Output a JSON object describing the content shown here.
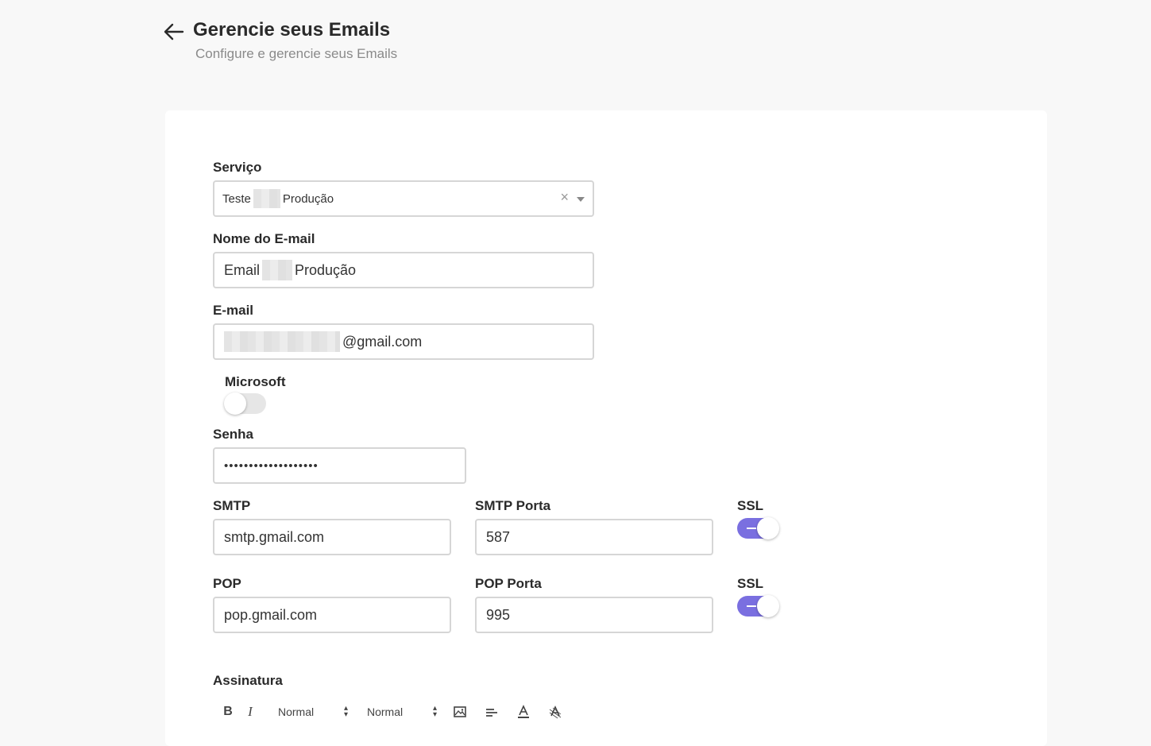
{
  "header": {
    "title": "Gerencie seus Emails",
    "subtitle": "Configure e gerencie seus Emails"
  },
  "form": {
    "servico": {
      "label": "Serviço",
      "value_prefix": "Teste",
      "value_suffix": "Produção"
    },
    "nome_email": {
      "label": "Nome do E-mail",
      "value_prefix": "Email",
      "value_suffix": "Produção"
    },
    "email": {
      "label": "E-mail",
      "value_suffix": "@gmail.com"
    },
    "microsoft": {
      "label": "Microsoft",
      "enabled": false
    },
    "senha": {
      "label": "Senha",
      "value": "•••••••••••••••••••"
    },
    "smtp": {
      "label": "SMTP",
      "value": "smtp.gmail.com"
    },
    "smtp_porta": {
      "label": "SMTP Porta",
      "value": "587"
    },
    "smtp_ssl": {
      "label": "SSL",
      "enabled": true
    },
    "pop": {
      "label": "POP",
      "value": "pop.gmail.com"
    },
    "pop_porta": {
      "label": "POP Porta",
      "value": "995"
    },
    "pop_ssl": {
      "label": "SSL",
      "enabled": true
    },
    "assinatura": {
      "label": "Assinatura"
    }
  },
  "editor_toolbar": {
    "bold": "B",
    "italic": "I",
    "size_select": "Normal",
    "header_select": "Normal"
  },
  "colors": {
    "accent": "#7a6fe0",
    "background": "#f8f8f8",
    "card": "#ffffff"
  }
}
